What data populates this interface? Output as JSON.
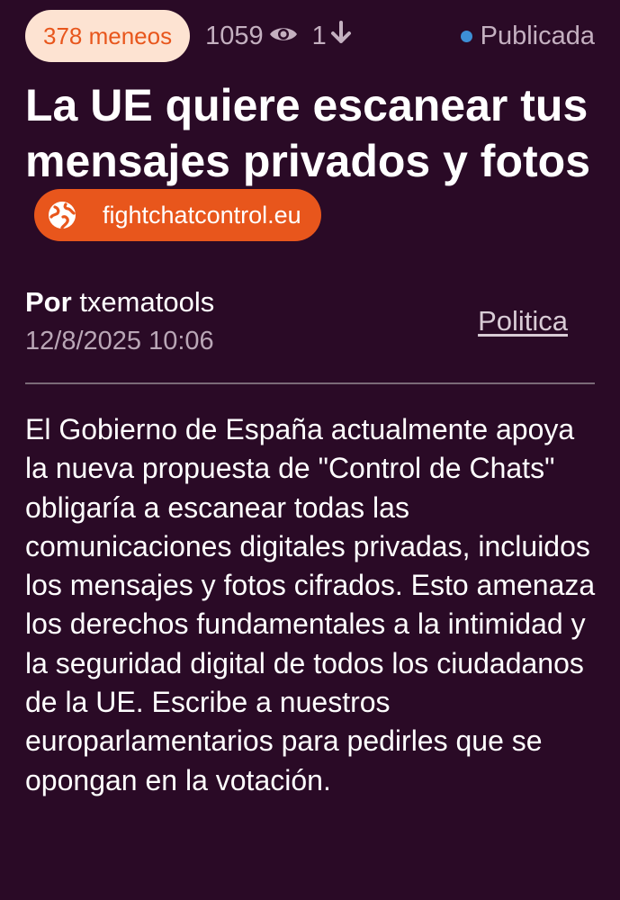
{
  "stats": {
    "votes_label": "378 meneos",
    "views_count": "1059",
    "downvotes_count": "1",
    "status_label": "Publicada",
    "icons": [
      "eye-icon",
      "arrow-down-icon"
    ],
    "status_dot_color": "#3d8fd6"
  },
  "article": {
    "title": "La UE quiere escanear tus mensajes privados y fotos",
    "source_domain": "fightchatcontrol.eu",
    "source_icon": "globe-icon",
    "author_prefix": "Por",
    "author": "txematools",
    "date": "12/8/2025 10:06",
    "category": "Politica",
    "body": "El Gobierno de España actualmente apoya la nueva propuesta de \"Control de Chats\" obligaría a escanear todas las comunicaciones digitales privadas, incluidos los mensajes y fotos cifrados. Esto amenaza los derechos fundamentales a la intimidad y la seguridad digital de todos los ciudadanos de la UE. Escribe a nuestros europarlamentarios para pedirles que se opongan en la votación."
  },
  "colors": {
    "background": "#2a0a26",
    "accent": "#e8561c",
    "badge_bg": "#fde3d2",
    "muted_text": "#c4b0c0"
  }
}
